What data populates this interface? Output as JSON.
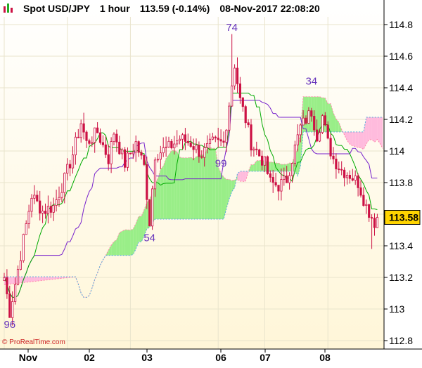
{
  "header": {
    "instrument": "Spot USD/JPY",
    "timeframe": "1 hour",
    "price_change": "113.59 (-0.14%)",
    "timestamp": "08-Nov-2017 22:08:20"
  },
  "watermark": "© ProRealTime.com",
  "colors": {
    "candle": "#cc1144",
    "tenkan": "#00aa00",
    "kijun": "#7722cc",
    "cloud_bull": "#99ee88",
    "cloud_bear": "#ffbbdd",
    "bg_top": "#ffffff",
    "bg_bottom": "#fff6d8",
    "last_price_bg": "#ffd400",
    "annotation": "#6633bb"
  },
  "chart_data": {
    "type": "candlestick",
    "title": "Spot USD/JPY",
    "ylim": [
      112.75,
      114.9
    ],
    "y_ticks": [
      "114.8",
      "114.6",
      "114.4",
      "114.2",
      "114",
      "113.8",
      "113.6",
      "113.4",
      "113.2",
      "113",
      "112.8"
    ],
    "x_ticks": [
      "Nov",
      "02",
      "03",
      "06",
      "07",
      "08"
    ],
    "last_price": "113.58",
    "annotations": [
      {
        "text": "96",
        "bar": 2,
        "value": 112.88
      },
      {
        "text": "54",
        "bar": 53,
        "value": 113.43
      },
      {
        "text": "74",
        "bar": 83,
        "value": 114.76
      },
      {
        "text": "99",
        "bar": 79,
        "value": 113.9
      },
      {
        "text": "34",
        "bar": 112,
        "value": 114.42
      }
    ],
    "indicators": [
      "Tenkan-sen",
      "Kijun-sen",
      "Senkou Span A",
      "Senkou Span B"
    ]
  }
}
